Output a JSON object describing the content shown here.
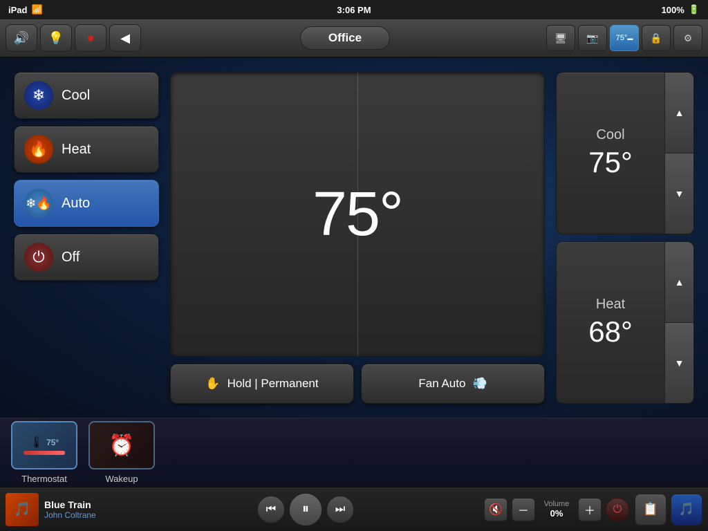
{
  "statusBar": {
    "device": "iPad",
    "wifi": "WiFi",
    "time": "3:06 PM",
    "battery": "100%"
  },
  "topNav": {
    "roomTitle": "Office",
    "buttons": [
      {
        "id": "sound",
        "icon": "🔊"
      },
      {
        "id": "light",
        "icon": "💡"
      },
      {
        "id": "record",
        "icon": "⏺"
      },
      {
        "id": "back",
        "icon": "◀"
      }
    ],
    "rightIcons": [
      {
        "id": "tv",
        "icon": "🖥",
        "active": false
      },
      {
        "id": "camera",
        "icon": "📷",
        "active": false
      },
      {
        "id": "thermostat",
        "icon": "T",
        "active": true
      },
      {
        "id": "lock",
        "icon": "🔒",
        "active": false
      },
      {
        "id": "settings",
        "icon": "⚙",
        "active": false
      }
    ]
  },
  "thermostat": {
    "currentTemp": "75°",
    "modes": [
      {
        "id": "cool",
        "label": "Cool",
        "icon": "❄",
        "active": false
      },
      {
        "id": "heat",
        "label": "Heat",
        "icon": "🔥",
        "active": false
      },
      {
        "id": "auto",
        "label": "Auto",
        "icon": "❄",
        "active": true
      },
      {
        "id": "off",
        "label": "Off",
        "icon": "⏻",
        "active": false
      }
    ],
    "holdLabel": "Hold | Permanent",
    "fanLabel": "Fan Auto",
    "fanIcon": "💨",
    "holdIcon": "✋",
    "setpoints": [
      {
        "id": "cool",
        "label": "Cool",
        "value": "75°"
      },
      {
        "id": "heat",
        "label": "Heat",
        "value": "68°"
      }
    ]
  },
  "shelf": [
    {
      "id": "thermostat",
      "label": "Thermostat",
      "temp": "75°",
      "selected": true
    },
    {
      "id": "wakeup",
      "label": "Wakeup",
      "selected": false
    }
  ],
  "mediaBar": {
    "trackTitle": "Blue Train",
    "trackArtist": "John Coltrane",
    "volumeLabel": "Volume",
    "volumeValue": "0%"
  }
}
